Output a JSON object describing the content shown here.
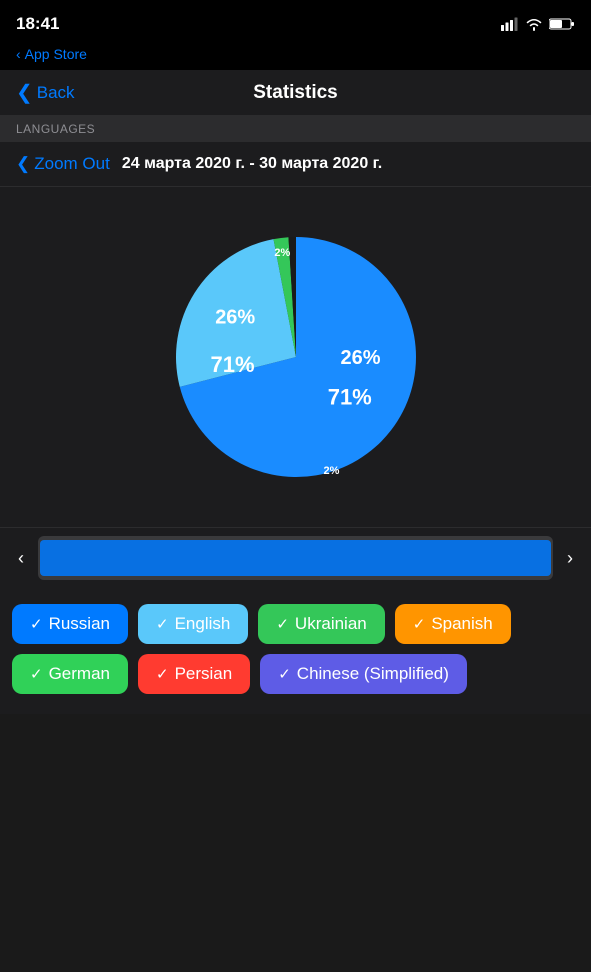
{
  "statusBar": {
    "time": "18:41",
    "appStoreBack": "App Store"
  },
  "navBar": {
    "backLabel": "Back",
    "title": "Statistics"
  },
  "sectionHeader": "LANGUAGES",
  "zoomBar": {
    "zoomOut": "Zoom Out",
    "dateRange": "24 марта 2020 г. - 30 марта 2020 г."
  },
  "chart": {
    "segments": [
      {
        "label": "71%",
        "color": "#007aff",
        "percent": 71
      },
      {
        "label": "26%",
        "color": "#5ac8fa",
        "percent": 26
      },
      {
        "label": "2%",
        "color": "#34c759",
        "percent": 2
      },
      {
        "label": "",
        "color": "#2c2c2e",
        "percent": 1
      }
    ]
  },
  "languageTags": [
    {
      "id": "russian",
      "label": "Russian",
      "class": "tag-russian"
    },
    {
      "id": "english",
      "label": "English",
      "class": "tag-english"
    },
    {
      "id": "ukrainian",
      "label": "Ukrainian",
      "class": "tag-ukrainian"
    },
    {
      "id": "spanish",
      "label": "Spanish",
      "class": "tag-spanish"
    },
    {
      "id": "german",
      "label": "German",
      "class": "tag-german"
    },
    {
      "id": "persian",
      "label": "Persian",
      "class": "tag-persian"
    },
    {
      "id": "chinese",
      "label": "Chinese (Simplified)",
      "class": "tag-chinese"
    }
  ],
  "icons": {
    "chevronLeft": "‹",
    "chevronRight": "›",
    "check": "✓"
  }
}
